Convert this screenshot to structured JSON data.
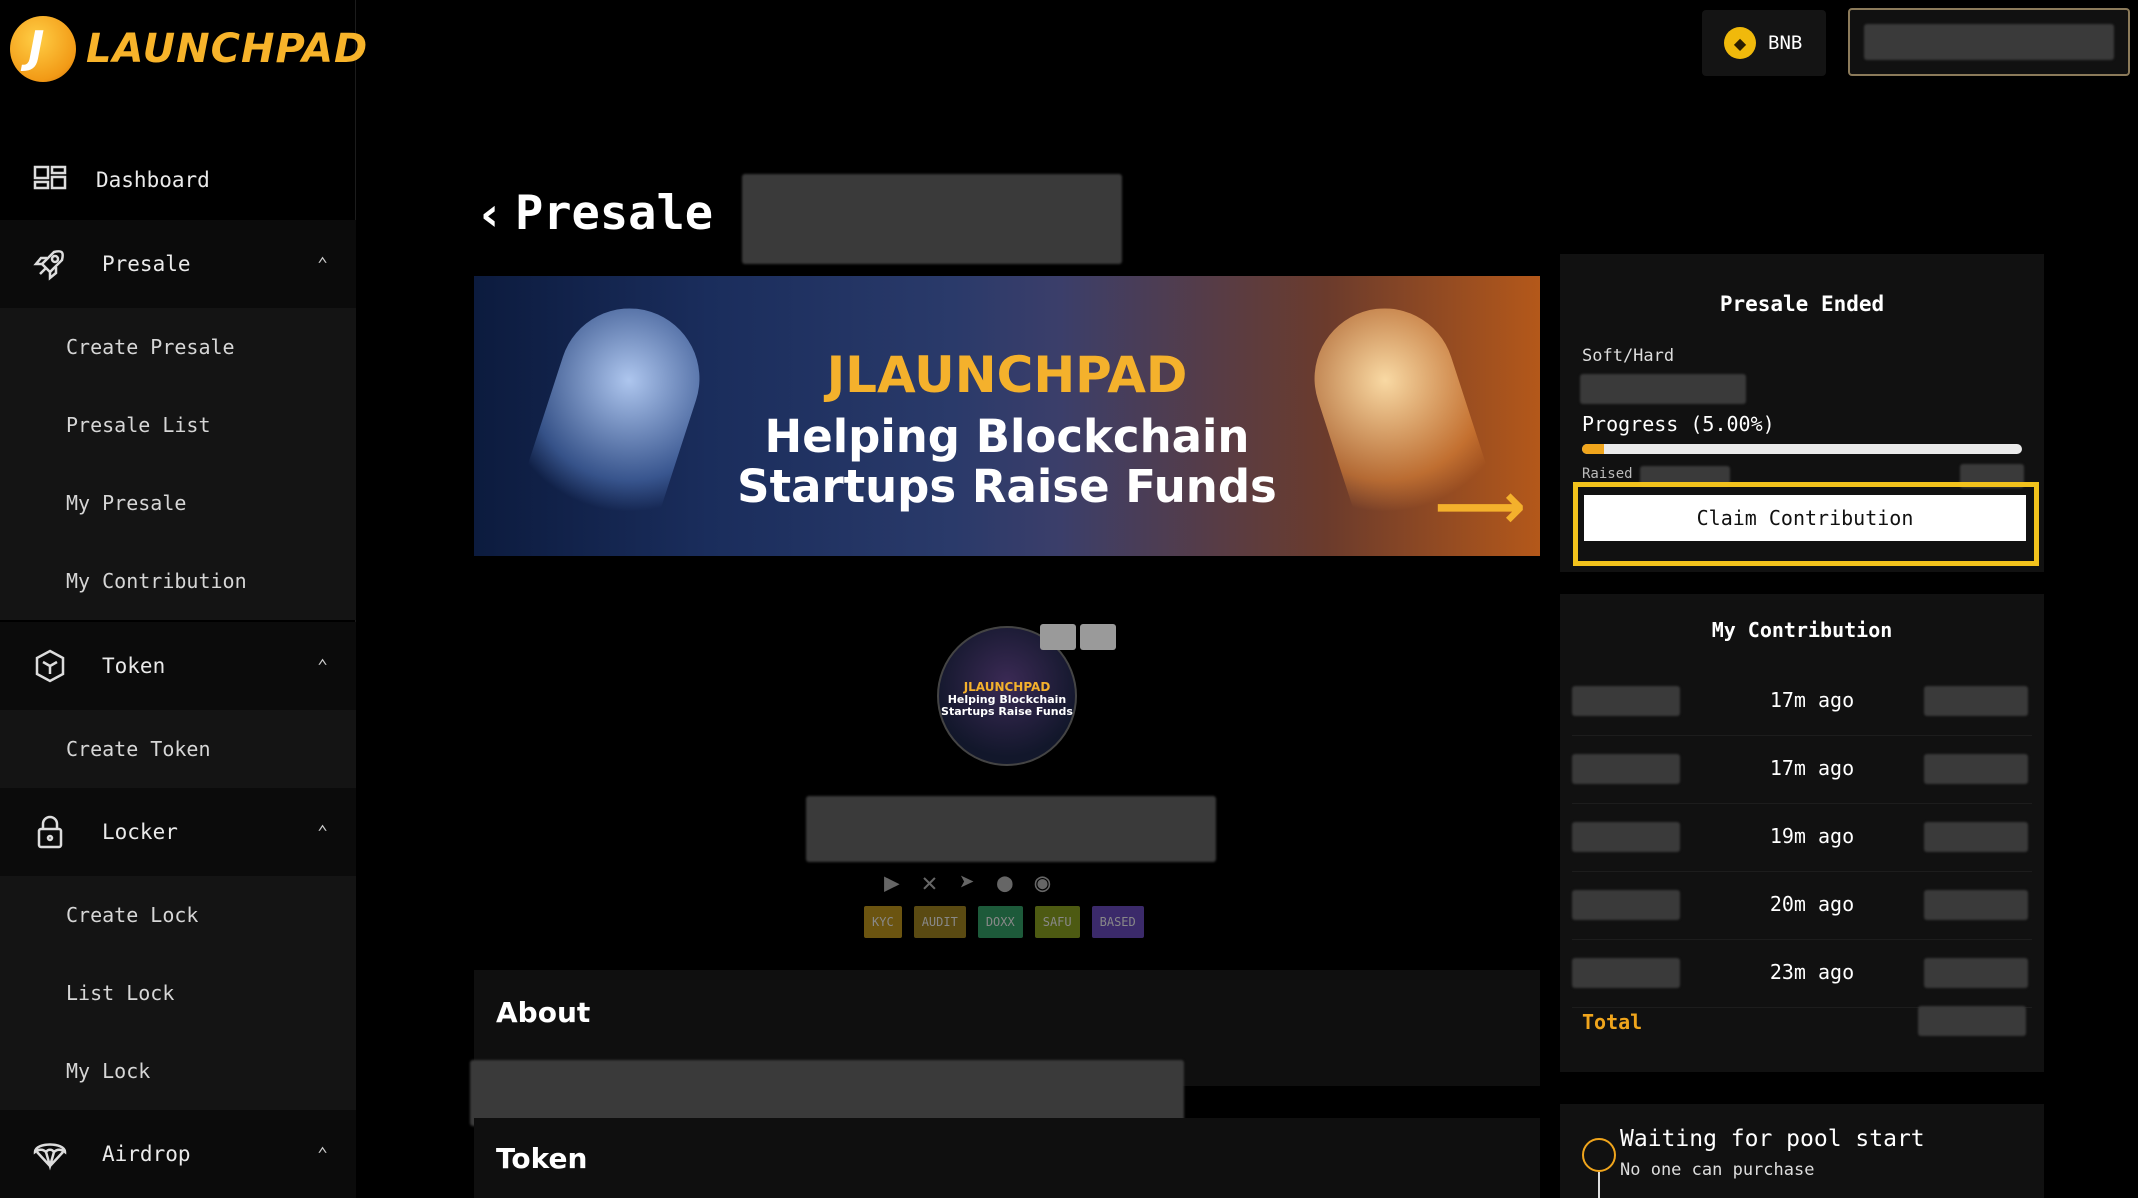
{
  "brand": {
    "name": "LAUNCHPAD",
    "mark": "J"
  },
  "sidebar": {
    "dashboard": "Dashboard",
    "presale": {
      "label": "Presale",
      "items": [
        "Create Presale",
        "Presale List",
        "My Presale",
        "My Contribution"
      ]
    },
    "token": {
      "label": "Token",
      "items": [
        "Create Token"
      ]
    },
    "locker": {
      "label": "Locker",
      "items": [
        "Create Lock",
        "List Lock",
        "My Lock"
      ]
    },
    "airdrop": {
      "label": "Airdrop"
    }
  },
  "topbar": {
    "network": "BNB"
  },
  "page": {
    "title": "Presale"
  },
  "banner": {
    "brand": "JLAUNCHPAD",
    "tagline_1": "Helping Blockchain",
    "tagline_2": "Startups Raise Funds"
  },
  "avatar": {
    "brand": "JLAUNCHPAD",
    "line1": "Helping Blockchain",
    "line2": "Startups Raise Funds"
  },
  "tags": [
    {
      "label": "KYC",
      "color": "#6b5410"
    },
    {
      "label": "AUDIT",
      "color": "#5a4a12"
    },
    {
      "label": "DOXX",
      "color": "#1d5a3a"
    },
    {
      "label": "SAFU",
      "color": "#4d5a12"
    },
    {
      "label": "BASED",
      "color": "#3b2a6a"
    }
  ],
  "sections": {
    "about": "About",
    "token": "Token"
  },
  "status_panel": {
    "title": "Presale Ended",
    "softhard_label": "Soft/Hard",
    "progress_label": "Progress (5.00%)",
    "progress_fraction": 0.05,
    "raised_label": "Raised",
    "claim_button": "Claim Contribution"
  },
  "contributions": {
    "title": "My Contribution",
    "rows": [
      {
        "time": "17m ago"
      },
      {
        "time": "17m ago"
      },
      {
        "time": "19m ago"
      },
      {
        "time": "20m ago"
      },
      {
        "time": "23m ago"
      }
    ],
    "total_label": "Total"
  },
  "pool_status": {
    "title": "Waiting for pool start",
    "subtitle": "No one can purchase"
  },
  "colors": {
    "accent": "#f0a51c",
    "highlight": "#f2c21c",
    "background": "#000000",
    "panel": "#111111"
  }
}
